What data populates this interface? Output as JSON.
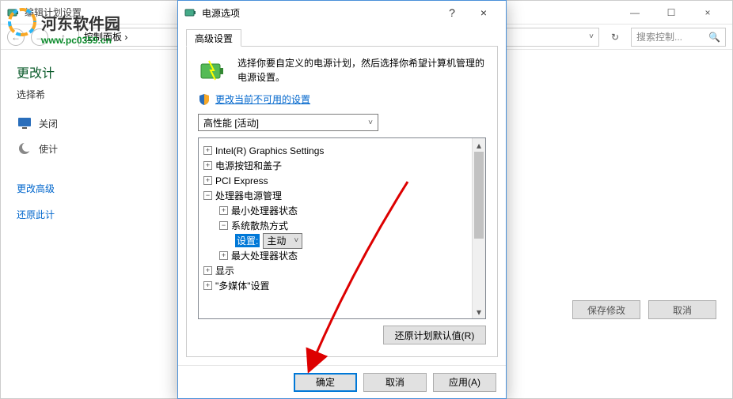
{
  "watermark": {
    "site_name": "河东软件园",
    "url": "www.pc0359.cn"
  },
  "bg": {
    "window_title": "编辑计划设置",
    "breadcrumb": "控制面板 ›",
    "search_placeholder": "搜索控制...",
    "refresh_tip": "↻",
    "heading": "更改计",
    "subtext": "选择希",
    "row1": "关闭",
    "row2": "使计",
    "link1": "更改高级",
    "link2": "还原此计",
    "btn_save": "保存修改",
    "btn_cancel": "取消"
  },
  "dlg": {
    "title": "电源选项",
    "help": "?",
    "close": "×",
    "tab": "高级设置",
    "description": "选择你要自定义的电源计划，然后选择你希望计算机管理的电源设置。",
    "unavailable_link": "更改当前不可用的设置",
    "plan_selected": "高性能 [活动]",
    "tree": {
      "n0": "Intel(R) Graphics Settings",
      "n1": "电源按钮和盖子",
      "n2": "PCI Express",
      "n3": "处理器电源管理",
      "n3a": "最小处理器状态",
      "n3b": "系统散热方式",
      "n3b_setting_label": "设置:",
      "n3b_setting_value": "主动",
      "n3c": "最大处理器状态",
      "n4": "显示",
      "n5": "\"多媒体\"设置"
    },
    "restore_btn": "还原计划默认值(R)",
    "ok": "确定",
    "cancel": "取消",
    "apply": "应用(A)"
  }
}
